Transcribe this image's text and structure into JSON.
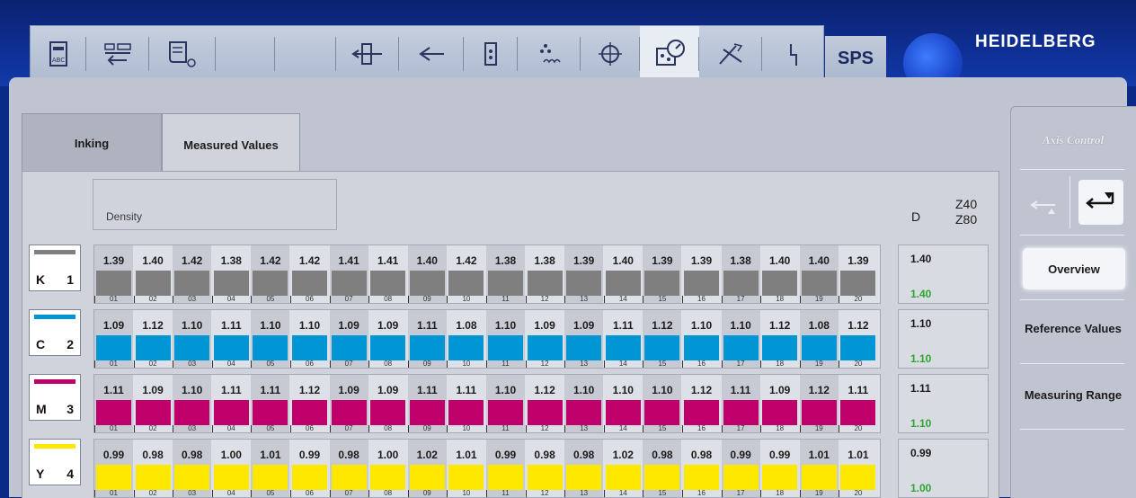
{
  "toolbar": {
    "tools": [
      "abc-icon",
      "ink-transfer-icon",
      "job-list-icon",
      "blank-icon",
      "register-icon",
      "feed-icon",
      "delivery-icon",
      "dampening-icon",
      "crosshair-icon",
      "measurement-icon",
      "service-icon",
      "power-icon"
    ],
    "sps_label": "SPS",
    "brand": "HEIDELBERG"
  },
  "tabs": {
    "inking": "Inking",
    "measured_values": "Measured Values"
  },
  "header": {
    "density_label": "Density",
    "d_label": "D",
    "z40": "Z40",
    "z80": "Z80"
  },
  "colors": {
    "K": "#7f7f7f",
    "C": "#0096d6",
    "M": "#c0006a",
    "Y": "#ffe800",
    "green": "#2fa62f"
  },
  "zones": [
    "01",
    "02",
    "03",
    "04",
    "05",
    "06",
    "07",
    "08",
    "09",
    "10",
    "11",
    "12",
    "13",
    "14",
    "15",
    "16",
    "17",
    "18",
    "19",
    "20"
  ],
  "rows": [
    {
      "letter": "K",
      "unit": "1",
      "color": "#7f7f7f",
      "swatch": "#808080",
      "values": [
        "1.39",
        "1.40",
        "1.42",
        "1.38",
        "1.42",
        "1.42",
        "1.41",
        "1.41",
        "1.40",
        "1.42",
        "1.38",
        "1.38",
        "1.39",
        "1.40",
        "1.39",
        "1.39",
        "1.38",
        "1.40",
        "1.40",
        "1.39"
      ],
      "measured": "1.40",
      "reference": "1.40"
    },
    {
      "letter": "C",
      "unit": "2",
      "color": "#0096d6",
      "swatch": "#0096d6",
      "values": [
        "1.09",
        "1.12",
        "1.10",
        "1.11",
        "1.10",
        "1.10",
        "1.09",
        "1.09",
        "1.11",
        "1.08",
        "1.10",
        "1.09",
        "1.09",
        "1.11",
        "1.12",
        "1.10",
        "1.10",
        "1.12",
        "1.08",
        "1.12"
      ],
      "measured": "1.10",
      "reference": "1.10"
    },
    {
      "letter": "M",
      "unit": "3",
      "color": "#c0006a",
      "swatch": "#c0006a",
      "values": [
        "1.11",
        "1.09",
        "1.10",
        "1.11",
        "1.11",
        "1.12",
        "1.09",
        "1.09",
        "1.11",
        "1.11",
        "1.10",
        "1.12",
        "1.10",
        "1.10",
        "1.10",
        "1.12",
        "1.11",
        "1.09",
        "1.12",
        "1.11"
      ],
      "measured": "1.11",
      "reference": "1.10"
    },
    {
      "letter": "Y",
      "unit": "4",
      "color": "#ffe800",
      "swatch": "#ffe800",
      "values": [
        "0.99",
        "0.98",
        "0.98",
        "1.00",
        "1.01",
        "0.99",
        "0.98",
        "1.00",
        "1.02",
        "1.01",
        "0.99",
        "0.98",
        "0.98",
        "1.02",
        "0.98",
        "0.98",
        "0.99",
        "0.99",
        "1.01",
        "1.01"
      ],
      "measured": "0.99",
      "reference": "1.00"
    }
  ],
  "sidebar": {
    "axis_control": "Axis Control",
    "overview": "Overview",
    "reference_values": "Reference Values",
    "measuring_range": "Measuring Range"
  }
}
